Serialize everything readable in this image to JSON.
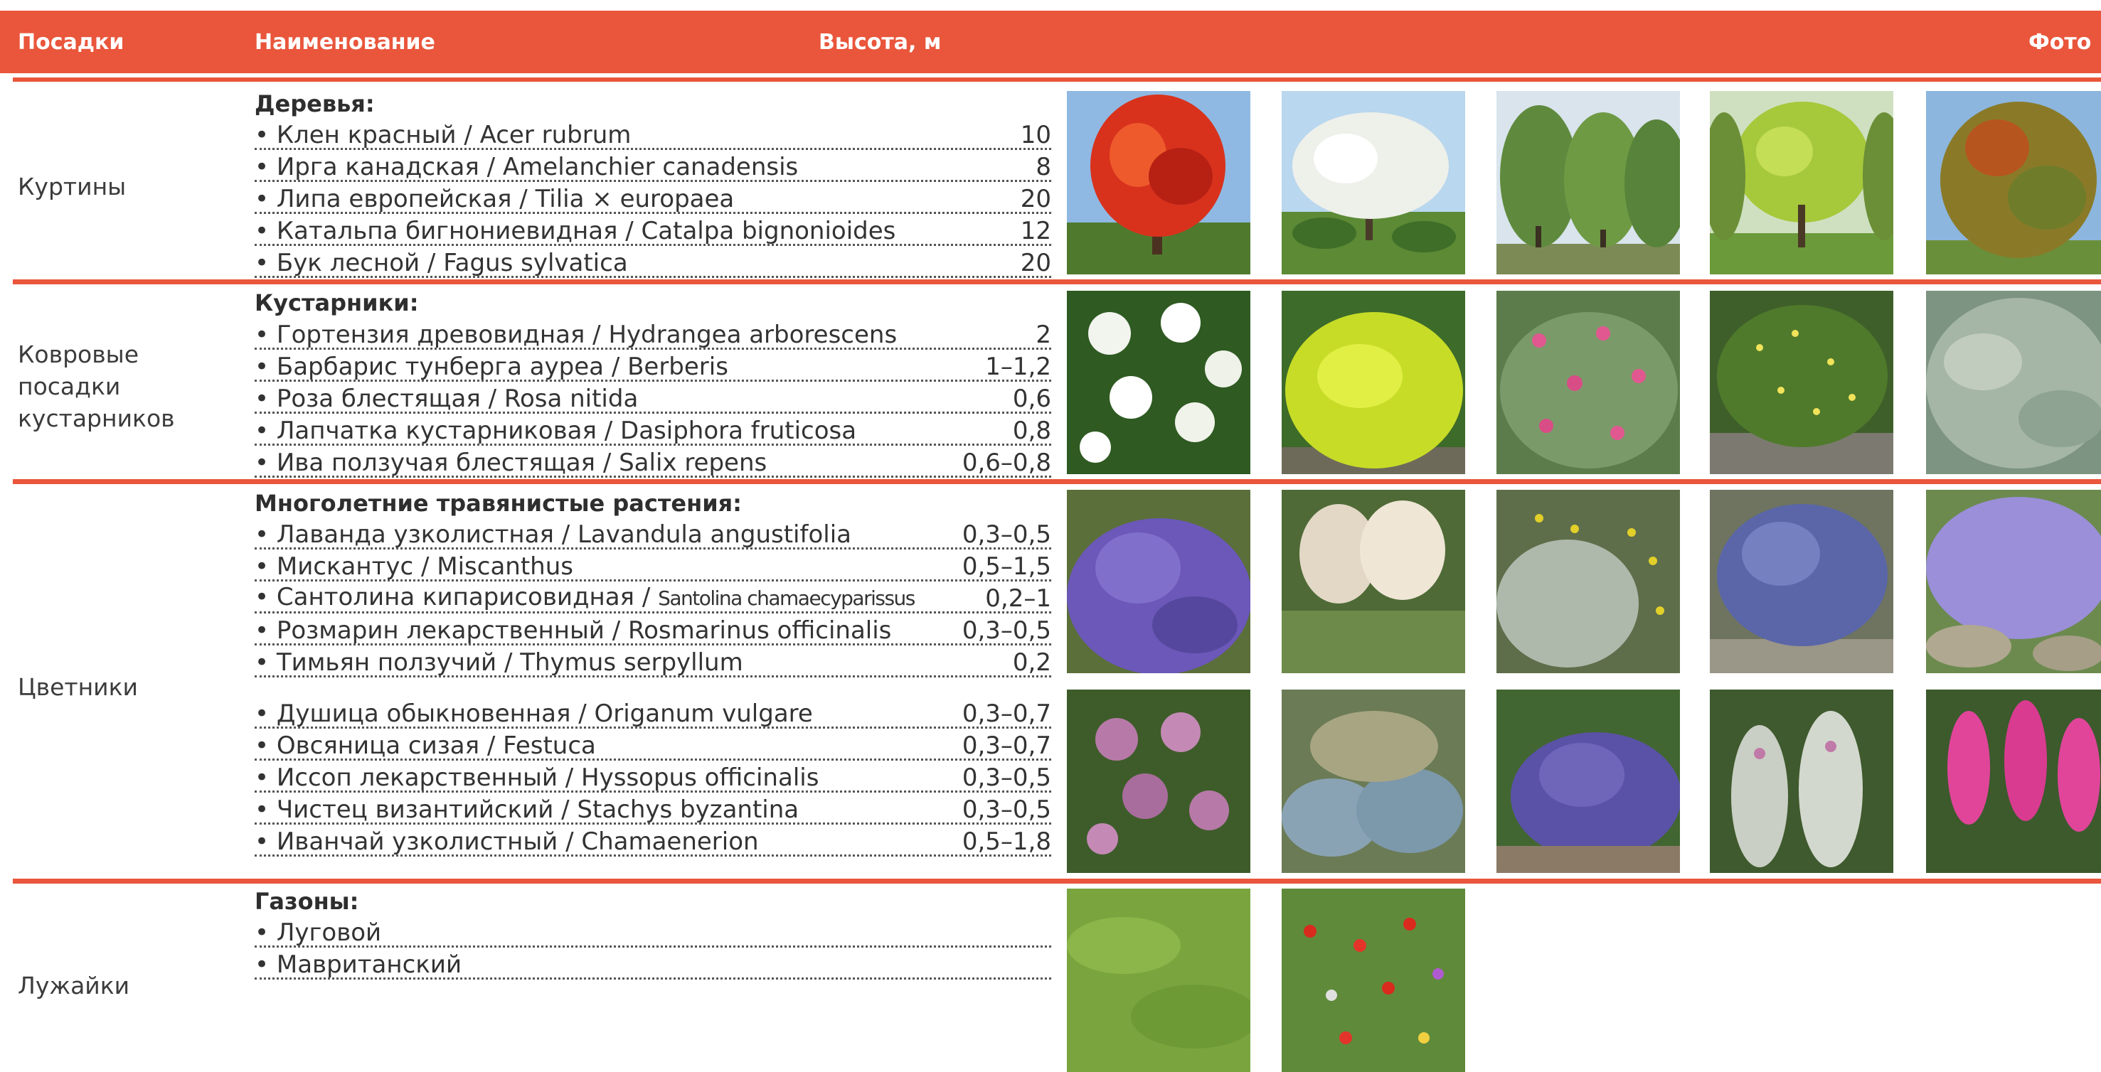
{
  "header": {
    "col_plantings": "Посадки",
    "col_name": "Наименование",
    "col_height": "Высота, м",
    "col_photo": "Фото"
  },
  "sections": {
    "trees": {
      "category": [
        "Куртины"
      ],
      "title": "Деревья:",
      "items": [
        {
          "name": "• Клен красный / Acer rubrum",
          "height": "10"
        },
        {
          "name": "• Ирга канадская / Amelanchier canadensis",
          "height": "8"
        },
        {
          "name": "• Липа европейская / Tilia × europaea",
          "height": "20"
        },
        {
          "name": "• Катальпа бигнониевидная / Catalpa bignonioides",
          "height": "12"
        },
        {
          "name": "• Бук лесной / Fagus sylvatica",
          "height": "20"
        }
      ]
    },
    "shrubs": {
      "category": [
        "Ковровые",
        "посадки",
        "кустарников"
      ],
      "title": "Кустарники:",
      "items": [
        {
          "name": "• Гортензия древовидная / Hydrangea arborescens",
          "height": "2"
        },
        {
          "name": "• Барбарис тунберга ауреа / Berberis",
          "height": "1–1,2"
        },
        {
          "name": "• Роза блестящая / Rosa nitida",
          "height": "0,6"
        },
        {
          "name": "• Лапчатка кустарниковая / Dasiphora fruticosa",
          "height": "0,8"
        },
        {
          "name": "• Ива ползучая блестящая / Salix repens",
          "height": "0,6–0,8"
        }
      ]
    },
    "flowerbeds": {
      "category": [
        "Цветники"
      ],
      "title": "Многолетние травянистые растения:",
      "items": [
        {
          "name": "• Лаванда узколистная / Lavandula angustifolia",
          "height": "0,3–0,5"
        },
        {
          "name": "• Мискантус / Miscanthus",
          "height": "0,5–1,5"
        },
        {
          "name_main": "• Сантолина кипарисовидная / ",
          "name_latin": "Santolina chamaecyparissus",
          "height": "0,2–1"
        },
        {
          "name": "• Розмарин лекарственный / Rosmarinus officinalis",
          "height": "0,3–0,5"
        },
        {
          "name": "• Тимьян ползучий / Thymus serpyllum",
          "height": "0,2"
        },
        {
          "name": "• Душица обыкновенная / Origanum vulgare",
          "height": "0,3–0,7"
        },
        {
          "name": "• Овсяница сизая / Festuca",
          "height": "0,3–0,7"
        },
        {
          "name": "• Иссоп лекарственный / Hyssopus officinalis",
          "height": "0,3–0,5"
        },
        {
          "name": "• Чистец византийский / Stachys byzantina",
          "height": "0,3–0,5"
        },
        {
          "name": "• Иванчай узколистный / Chamaenerion",
          "height": "0,5–1,8"
        }
      ]
    },
    "lawns": {
      "category": [
        "Лужайки"
      ],
      "title": "Газоны:",
      "items": [
        {
          "name": "• Луговой",
          "height": ""
        },
        {
          "name": "• Мавританский",
          "height": ""
        }
      ]
    }
  },
  "colors": {
    "accent": "#e9563b",
    "text": "#3c3c3c"
  }
}
